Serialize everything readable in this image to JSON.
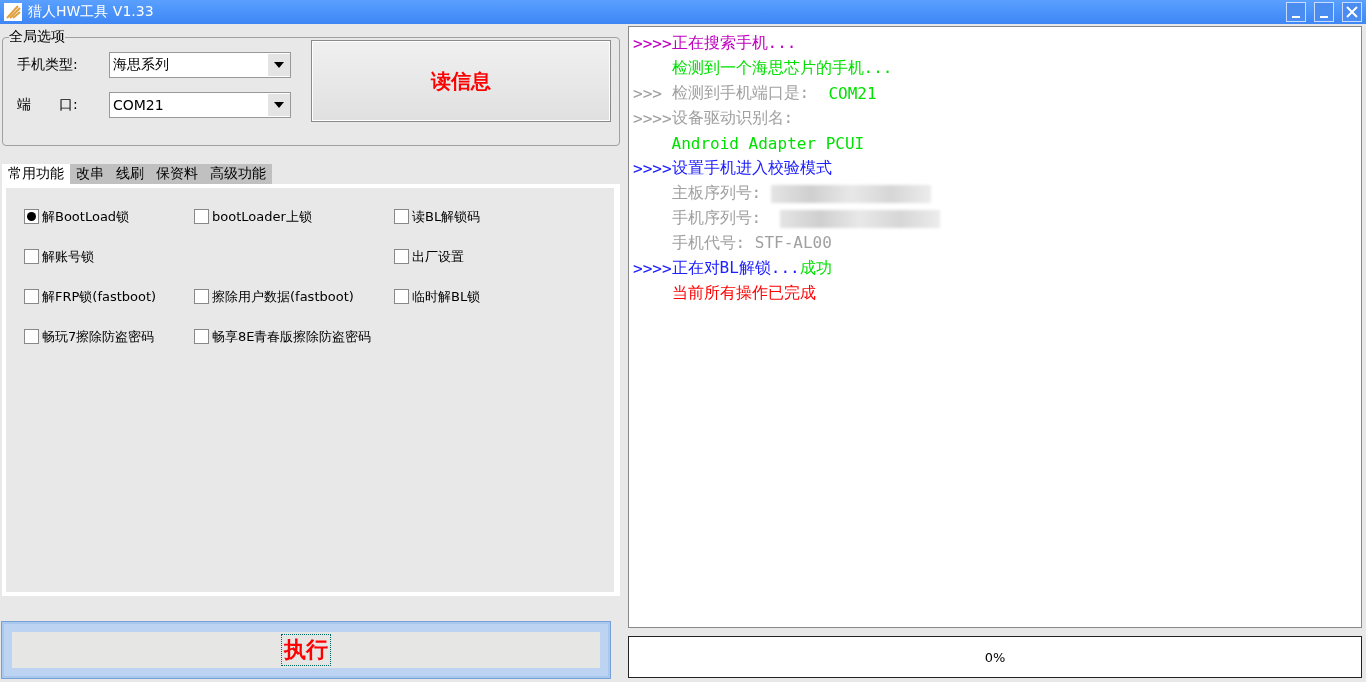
{
  "window": {
    "title": "猎人HW工具 V1.33"
  },
  "global_options": {
    "title": "全局选项",
    "fields": [
      {
        "label": "手机类型:",
        "value": "海思系列"
      },
      {
        "label": "端　　口:",
        "value": "COM21"
      }
    ],
    "read_button": "读信息"
  },
  "tabs": [
    {
      "label": "常用功能",
      "selected": true
    },
    {
      "label": "改串",
      "selected": false
    },
    {
      "label": "线刷",
      "selected": false
    },
    {
      "label": "保资料",
      "selected": false
    },
    {
      "label": "高级功能",
      "selected": false
    }
  ],
  "option_rows": [
    {
      "left": {
        "label": "解BootLoad锁",
        "checked": true
      },
      "middle": {
        "label": "bootLoader上锁",
        "checked": false
      },
      "right": {
        "label": "读BL解锁码",
        "checked": false
      }
    },
    {
      "left": {
        "label": "解账号锁",
        "checked": false
      },
      "right": {
        "label": "出厂设置",
        "checked": false
      }
    },
    {
      "left": {
        "label": "解FRP锁(fastboot)",
        "checked": false
      },
      "middle": {
        "label": "擦除用户数据(fastboot)",
        "checked": false
      },
      "right": {
        "label": "临时解BL锁",
        "checked": false
      }
    },
    {
      "left": {
        "label": "畅玩7擦除防盗密码",
        "checked": false
      },
      "middle": {
        "label": "畅享8E青春版擦除防盗密码",
        "checked": false
      }
    }
  ],
  "execute_button": "执行",
  "log": [
    {
      "segments": [
        {
          "text": ">>>>",
          "color": "#c000c0"
        },
        {
          "text": "正在搜索手机...",
          "color": "#c000c0"
        }
      ]
    },
    {
      "segments": [
        {
          "text": "    检测到一个海思芯片的手机...",
          "color": "#00e000"
        }
      ]
    },
    {
      "segments": [
        {
          "text": ">>> ",
          "color": "#a0a0a0"
        },
        {
          "text": "检测到手机端口是:  ",
          "color": "#a0a0a0"
        },
        {
          "text": "COM21",
          "color": "#00e000"
        }
      ]
    },
    {
      "segments": [
        {
          "text": ">>>>",
          "color": "#a0a0a0"
        },
        {
          "text": "设备驱动识别名:",
          "color": "#a0a0a0"
        }
      ]
    },
    {
      "segments": [
        {
          "text": "    Android Adapter PCUI",
          "color": "#00e000"
        }
      ]
    },
    {
      "segments": [
        {
          "text": ">>>>",
          "color": "#2020ff"
        },
        {
          "text": "设置手机进入校验模式",
          "color": "#2020ff"
        }
      ]
    },
    {
      "segments": [
        {
          "text": "    主板序列号: ",
          "color": "#a0a0a0"
        }
      ],
      "redacted": true
    },
    {
      "segments": [
        {
          "text": "    手机序列号:  ",
          "color": "#a0a0a0"
        }
      ],
      "redacted": true
    },
    {
      "segments": [
        {
          "text": "    手机代号: STF-AL00",
          "color": "#a0a0a0"
        }
      ]
    },
    {
      "segments": [
        {
          "text": ">>>>",
          "color": "#2020ff"
        },
        {
          "text": "正在对BL解锁...",
          "color": "#2020ff"
        },
        {
          "text": "成功",
          "color": "#00e000"
        }
      ]
    },
    {
      "segments": [
        {
          "text": "    当前所有操作已完成",
          "color": "#ff0000"
        }
      ]
    }
  ],
  "progress": {
    "level": 0,
    "reading": "0%"
  }
}
